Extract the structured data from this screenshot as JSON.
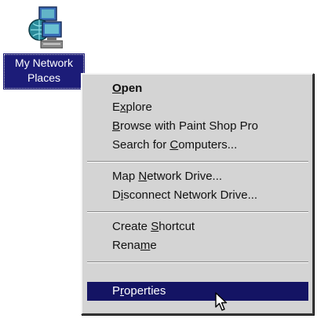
{
  "desktop_icon": {
    "label_line1": "My Network",
    "label_line2": "Places",
    "icon": "network-places-icon"
  },
  "context_menu": {
    "items": [
      {
        "pre": "",
        "key": "O",
        "post": "pen",
        "bold": true
      },
      {
        "pre": "E",
        "key": "x",
        "post": "plore"
      },
      {
        "pre": "",
        "key": "B",
        "post": "rowse with Paint Shop Pro"
      },
      {
        "pre": "Search for ",
        "key": "C",
        "post": "omputers..."
      },
      {
        "pre": "Map ",
        "key": "N",
        "post": "etwork Drive..."
      },
      {
        "pre": "D",
        "key": "i",
        "post": "sconnect Network Drive..."
      },
      {
        "pre": "Create ",
        "key": "S",
        "post": "hortcut"
      },
      {
        "pre": "Rena",
        "key": "m",
        "post": "e"
      },
      {
        "pre": "P",
        "key": "r",
        "post": "operties",
        "highlighted": true
      }
    ]
  },
  "colors": {
    "selection": "#141464",
    "menu_background": "#d4d4d4"
  },
  "cursor_icon": "arrow-cursor-icon"
}
